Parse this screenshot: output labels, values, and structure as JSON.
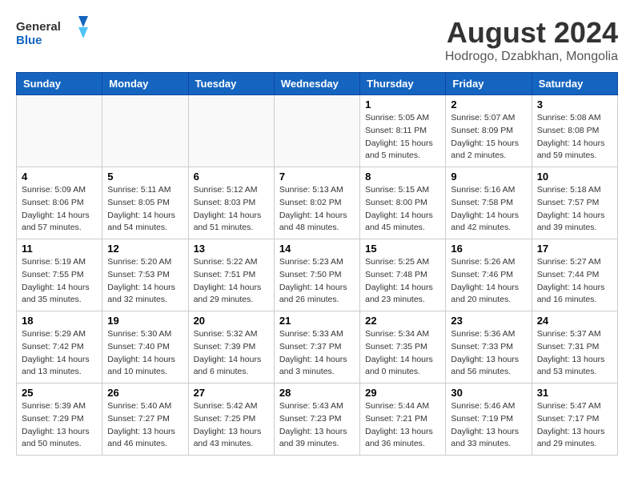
{
  "header": {
    "logo_line1": "General",
    "logo_line2": "Blue",
    "month_title": "August 2024",
    "location": "Hodrogo, Dzabkhan, Mongolia"
  },
  "weekdays": [
    "Sunday",
    "Monday",
    "Tuesday",
    "Wednesday",
    "Thursday",
    "Friday",
    "Saturday"
  ],
  "weeks": [
    [
      {
        "day": "",
        "info": ""
      },
      {
        "day": "",
        "info": ""
      },
      {
        "day": "",
        "info": ""
      },
      {
        "day": "",
        "info": ""
      },
      {
        "day": "1",
        "info": "Sunrise: 5:05 AM\nSunset: 8:11 PM\nDaylight: 15 hours\nand 5 minutes."
      },
      {
        "day": "2",
        "info": "Sunrise: 5:07 AM\nSunset: 8:09 PM\nDaylight: 15 hours\nand 2 minutes."
      },
      {
        "day": "3",
        "info": "Sunrise: 5:08 AM\nSunset: 8:08 PM\nDaylight: 14 hours\nand 59 minutes."
      }
    ],
    [
      {
        "day": "4",
        "info": "Sunrise: 5:09 AM\nSunset: 8:06 PM\nDaylight: 14 hours\nand 57 minutes."
      },
      {
        "day": "5",
        "info": "Sunrise: 5:11 AM\nSunset: 8:05 PM\nDaylight: 14 hours\nand 54 minutes."
      },
      {
        "day": "6",
        "info": "Sunrise: 5:12 AM\nSunset: 8:03 PM\nDaylight: 14 hours\nand 51 minutes."
      },
      {
        "day": "7",
        "info": "Sunrise: 5:13 AM\nSunset: 8:02 PM\nDaylight: 14 hours\nand 48 minutes."
      },
      {
        "day": "8",
        "info": "Sunrise: 5:15 AM\nSunset: 8:00 PM\nDaylight: 14 hours\nand 45 minutes."
      },
      {
        "day": "9",
        "info": "Sunrise: 5:16 AM\nSunset: 7:58 PM\nDaylight: 14 hours\nand 42 minutes."
      },
      {
        "day": "10",
        "info": "Sunrise: 5:18 AM\nSunset: 7:57 PM\nDaylight: 14 hours\nand 39 minutes."
      }
    ],
    [
      {
        "day": "11",
        "info": "Sunrise: 5:19 AM\nSunset: 7:55 PM\nDaylight: 14 hours\nand 35 minutes."
      },
      {
        "day": "12",
        "info": "Sunrise: 5:20 AM\nSunset: 7:53 PM\nDaylight: 14 hours\nand 32 minutes."
      },
      {
        "day": "13",
        "info": "Sunrise: 5:22 AM\nSunset: 7:51 PM\nDaylight: 14 hours\nand 29 minutes."
      },
      {
        "day": "14",
        "info": "Sunrise: 5:23 AM\nSunset: 7:50 PM\nDaylight: 14 hours\nand 26 minutes."
      },
      {
        "day": "15",
        "info": "Sunrise: 5:25 AM\nSunset: 7:48 PM\nDaylight: 14 hours\nand 23 minutes."
      },
      {
        "day": "16",
        "info": "Sunrise: 5:26 AM\nSunset: 7:46 PM\nDaylight: 14 hours\nand 20 minutes."
      },
      {
        "day": "17",
        "info": "Sunrise: 5:27 AM\nSunset: 7:44 PM\nDaylight: 14 hours\nand 16 minutes."
      }
    ],
    [
      {
        "day": "18",
        "info": "Sunrise: 5:29 AM\nSunset: 7:42 PM\nDaylight: 14 hours\nand 13 minutes."
      },
      {
        "day": "19",
        "info": "Sunrise: 5:30 AM\nSunset: 7:40 PM\nDaylight: 14 hours\nand 10 minutes."
      },
      {
        "day": "20",
        "info": "Sunrise: 5:32 AM\nSunset: 7:39 PM\nDaylight: 14 hours\nand 6 minutes."
      },
      {
        "day": "21",
        "info": "Sunrise: 5:33 AM\nSunset: 7:37 PM\nDaylight: 14 hours\nand 3 minutes."
      },
      {
        "day": "22",
        "info": "Sunrise: 5:34 AM\nSunset: 7:35 PM\nDaylight: 14 hours\nand 0 minutes."
      },
      {
        "day": "23",
        "info": "Sunrise: 5:36 AM\nSunset: 7:33 PM\nDaylight: 13 hours\nand 56 minutes."
      },
      {
        "day": "24",
        "info": "Sunrise: 5:37 AM\nSunset: 7:31 PM\nDaylight: 13 hours\nand 53 minutes."
      }
    ],
    [
      {
        "day": "25",
        "info": "Sunrise: 5:39 AM\nSunset: 7:29 PM\nDaylight: 13 hours\nand 50 minutes."
      },
      {
        "day": "26",
        "info": "Sunrise: 5:40 AM\nSunset: 7:27 PM\nDaylight: 13 hours\nand 46 minutes."
      },
      {
        "day": "27",
        "info": "Sunrise: 5:42 AM\nSunset: 7:25 PM\nDaylight: 13 hours\nand 43 minutes."
      },
      {
        "day": "28",
        "info": "Sunrise: 5:43 AM\nSunset: 7:23 PM\nDaylight: 13 hours\nand 39 minutes."
      },
      {
        "day": "29",
        "info": "Sunrise: 5:44 AM\nSunset: 7:21 PM\nDaylight: 13 hours\nand 36 minutes."
      },
      {
        "day": "30",
        "info": "Sunrise: 5:46 AM\nSunset: 7:19 PM\nDaylight: 13 hours\nand 33 minutes."
      },
      {
        "day": "31",
        "info": "Sunrise: 5:47 AM\nSunset: 7:17 PM\nDaylight: 13 hours\nand 29 minutes."
      }
    ]
  ]
}
